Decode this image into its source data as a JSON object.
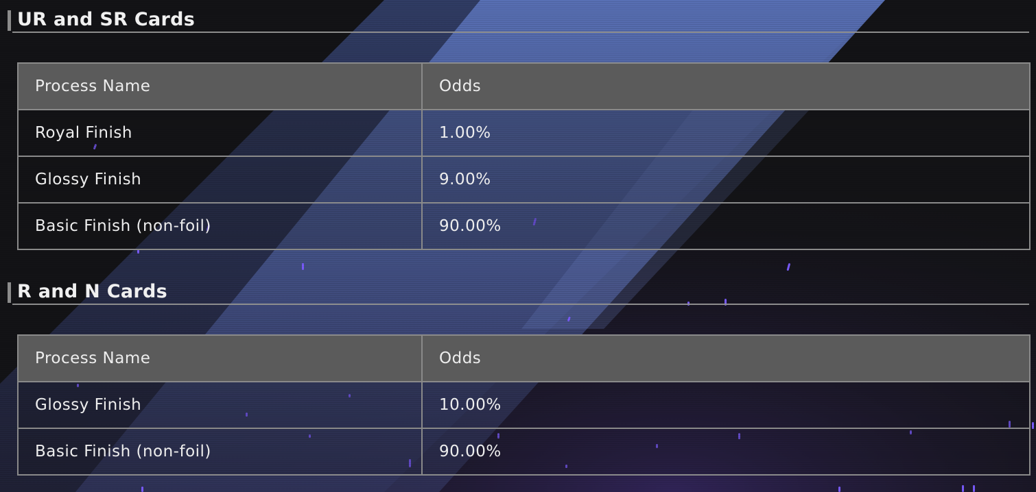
{
  "sections": [
    {
      "title": "UR and SR Cards",
      "headers": [
        "Process Name",
        "Odds"
      ],
      "rows": [
        [
          "Royal Finish",
          "1.00%"
        ],
        [
          "Glossy Finish",
          "9.00%"
        ],
        [
          "Basic Finish (non-foil)",
          "90.00%"
        ]
      ]
    },
    {
      "title": "R and N Cards",
      "headers": [
        "Process Name",
        "Odds"
      ],
      "rows": [
        [
          "Glossy Finish",
          "10.00%"
        ],
        [
          "Basic Finish (non-foil)",
          "90.00%"
        ]
      ]
    }
  ],
  "colors": {
    "background": "#121214",
    "stripe": "#5a6fae",
    "header_row": "#5b5b5b",
    "border": "#8a8a8a",
    "particle": "#7b5cff"
  }
}
